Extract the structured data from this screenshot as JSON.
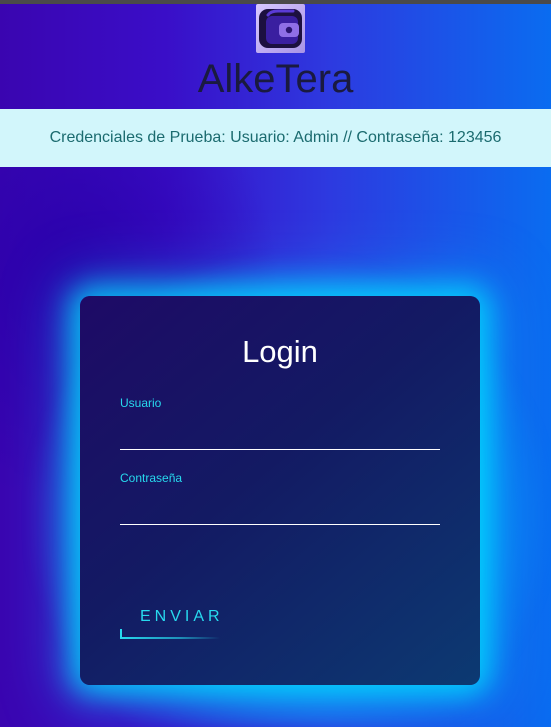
{
  "header": {
    "logo_icon": "wallet-icon",
    "brand": "AlkeTera"
  },
  "banner": {
    "text": "Credenciales de Prueba: Usuario: Admin // Contraseña: 123456"
  },
  "login": {
    "title": "Login",
    "username_label": "Usuario",
    "username_value": "",
    "password_label": "Contraseña",
    "password_value": "",
    "submit_label": "ENVIAR"
  },
  "colors": {
    "accent": "#27d9ee",
    "banner_bg": "#d2f6fb",
    "banner_text": "#1b6b6f",
    "card_bg": "#131a63",
    "page_bg_start": "#3a05b0",
    "page_bg_end": "#0a6cf0"
  }
}
